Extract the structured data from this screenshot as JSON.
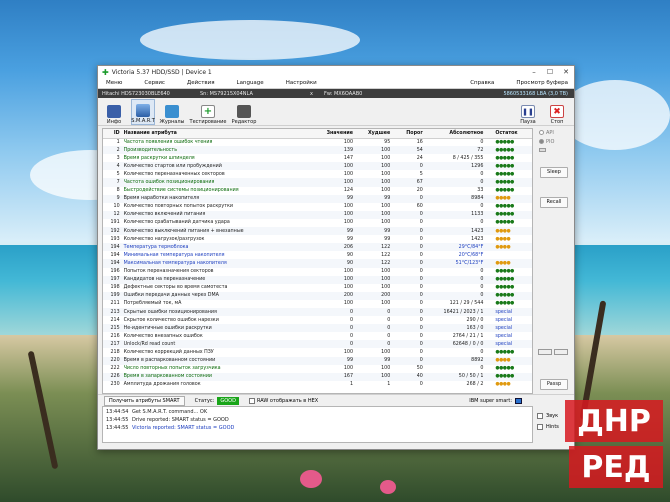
{
  "window": {
    "title": "Victoria 5.37 HDD/SSD | Device 1",
    "controls": [
      "–",
      "☐",
      "✕"
    ]
  },
  "menu": [
    "Меню",
    "Сервис",
    "Действия",
    "Language",
    "Настройки",
    "Справка",
    "Просмотр буфера"
  ],
  "device": {
    "model": "Hitachi HDS723030BLE640",
    "serial": "Sn: MS79215X04NLA",
    "sep": "x",
    "firmware": "Fw: MX6OAAB0",
    "capacity": "5860533168 LBA (3,0 TB)"
  },
  "toolbar": {
    "info": "Инфо",
    "smart": "S.M.A.R.T",
    "journals": "Журналы",
    "testing": "Тестирование",
    "editor": "Редактор",
    "pause": "Пауза",
    "stop": "Стоп"
  },
  "table": {
    "headers": [
      "ID",
      "Название атрибута",
      "Значение",
      "Худшее",
      "Порог",
      "Абсолютное",
      "Остаток"
    ],
    "rows": [
      {
        "id": "1",
        "name": "Частота появления ошибок чтения",
        "val": "100",
        "worst": "95",
        "thr": "16",
        "raw": "0",
        "rem": "●●●●●",
        "cls": "good",
        "remtype": "green"
      },
      {
        "id": "2",
        "name": "Производительность",
        "val": "139",
        "worst": "100",
        "thr": "54",
        "raw": "72",
        "rem": "●●●●●",
        "cls": "good",
        "remtype": "green"
      },
      {
        "id": "3",
        "name": "Время раскрутки шпинделя",
        "val": "147",
        "worst": "100",
        "thr": "24",
        "raw": "8 / 425 / 355",
        "rem": "●●●●●",
        "cls": "good",
        "remtype": "green"
      },
      {
        "id": "4",
        "name": "Количество стартов или пробуждений",
        "val": "100",
        "worst": "100",
        "thr": "0",
        "raw": "1296",
        "rem": "●●●●●",
        "cls": "",
        "remtype": "green"
      },
      {
        "id": "5",
        "name": "Количество переназначенных секторов",
        "val": "100",
        "worst": "100",
        "thr": "5",
        "raw": "0",
        "rem": "●●●●●",
        "cls": "",
        "remtype": "green"
      },
      {
        "id": "7",
        "name": "Частота ошибок позиционирования",
        "val": "100",
        "worst": "100",
        "thr": "67",
        "raw": "0",
        "rem": "●●●●●",
        "cls": "good",
        "remtype": "green"
      },
      {
        "id": "8",
        "name": "Быстродействие системы позиционирования",
        "val": "124",
        "worst": "100",
        "thr": "20",
        "raw": "33",
        "rem": "●●●●●",
        "cls": "good",
        "remtype": "green"
      },
      {
        "id": "9",
        "name": "Время наработки накопителя",
        "val": "99",
        "worst": "99",
        "thr": "0",
        "raw": "8984",
        "rem": "●●●●",
        "cls": "",
        "remtype": "orange"
      },
      {
        "id": "10",
        "name": "Количество повторных попыток раскрутки",
        "val": "100",
        "worst": "100",
        "thr": "60",
        "raw": "0",
        "rem": "●●●●●",
        "cls": "",
        "remtype": "green"
      },
      {
        "id": "12",
        "name": "Количество включений питания",
        "val": "100",
        "worst": "100",
        "thr": "0",
        "raw": "1133",
        "rem": "●●●●●",
        "cls": "",
        "remtype": "green"
      },
      {
        "id": "191",
        "name": "Количество срабатываний датчика удара",
        "val": "100",
        "worst": "100",
        "thr": "0",
        "raw": "0",
        "rem": "●●●●●",
        "cls": "",
        "remtype": "green"
      },
      {
        "id": "192",
        "name": "Количество выключений питания + внезапные",
        "val": "99",
        "worst": "99",
        "thr": "0",
        "raw": "1423",
        "rem": "●●●●",
        "cls": "",
        "remtype": "orange"
      },
      {
        "id": "193",
        "name": "Количество нагрузок/разгрузок",
        "val": "99",
        "worst": "99",
        "thr": "0",
        "raw": "1423",
        "rem": "●●●●",
        "cls": "",
        "remtype": "orange"
      },
      {
        "id": "194",
        "name": "Температура термоблока",
        "val": "206",
        "worst": "122",
        "thr": "0",
        "raw": "29°C/84°F",
        "rem": "●●●●",
        "cls": "blue",
        "remtype": "orange"
      },
      {
        "id": "194",
        "name": "Минимальная температура накопителя",
        "val": "90",
        "worst": "122",
        "thr": "0",
        "raw": "20°C/68°F",
        "rem": "",
        "cls": "blue",
        "remtype": "orange"
      },
      {
        "id": "194",
        "name": "Максимальная температура накопителя",
        "val": "90",
        "worst": "122",
        "thr": "0",
        "raw": "51°C/123°F",
        "rem": "●●●●",
        "cls": "blue",
        "remtype": "orange"
      },
      {
        "id": "196",
        "name": "Попыток переназначения секторов",
        "val": "100",
        "worst": "100",
        "thr": "0",
        "raw": "0",
        "rem": "●●●●●",
        "cls": "",
        "remtype": "green"
      },
      {
        "id": "197",
        "name": "Кандидатов на переназначение",
        "val": "100",
        "worst": "100",
        "thr": "0",
        "raw": "0",
        "rem": "●●●●●",
        "cls": "",
        "remtype": "green"
      },
      {
        "id": "198",
        "name": "Дефектные секторы во время самотеста",
        "val": "100",
        "worst": "100",
        "thr": "0",
        "raw": "0",
        "rem": "●●●●●",
        "cls": "",
        "remtype": "green"
      },
      {
        "id": "199",
        "name": "Ошибки передачи данных через DMA",
        "val": "200",
        "worst": "200",
        "thr": "0",
        "raw": "0",
        "rem": "●●●●●",
        "cls": "",
        "remtype": "green"
      },
      {
        "id": "211",
        "name": "Потребляемый ток, мА",
        "val": "100",
        "worst": "100",
        "thr": "0",
        "raw": "121 / 29 / 544",
        "rem": "●●●●●",
        "cls": "",
        "remtype": "green"
      },
      {
        "id": "213",
        "name": "Скрытые ошибки позиционирования",
        "val": "0",
        "worst": "0",
        "thr": "0",
        "raw": "16421 / 2023 / 1",
        "rem": "special",
        "cls": "",
        "remtype": "special"
      },
      {
        "id": "214",
        "name": "Скрытое количество ошибок нарезки",
        "val": "0",
        "worst": "0",
        "thr": "0",
        "raw": "290 / 0",
        "rem": "special",
        "cls": "",
        "remtype": "special"
      },
      {
        "id": "215",
        "name": "Не-идентичные ошибки раскрутки",
        "val": "0",
        "worst": "0",
        "thr": "0",
        "raw": "163 / 0",
        "rem": "special",
        "cls": "",
        "remtype": "special"
      },
      {
        "id": "216",
        "name": "Количество внезапных ошибок",
        "val": "0",
        "worst": "0",
        "thr": "0",
        "raw": "2764 / 21 / 1",
        "rem": "special",
        "cls": "",
        "remtype": "special"
      },
      {
        "id": "217",
        "name": "Unlock/Rd read count",
        "val": "0",
        "worst": "0",
        "thr": "0",
        "raw": "62648 / 0 / 0",
        "rem": "special",
        "cls": "",
        "remtype": "special"
      },
      {
        "id": "218",
        "name": "Количество коррекций данных ПЗУ",
        "val": "100",
        "worst": "100",
        "thr": "0",
        "raw": "0",
        "rem": "●●●●●",
        "cls": "",
        "remtype": "green"
      },
      {
        "id": "220",
        "name": "Время в распаркованном состоянии",
        "val": "99",
        "worst": "99",
        "thr": "0",
        "raw": "8892",
        "rem": "●●●●",
        "cls": "",
        "remtype": "orange"
      },
      {
        "id": "222",
        "name": "Число повторных попыток загрузчика",
        "val": "100",
        "worst": "100",
        "thr": "50",
        "raw": "0",
        "rem": "●●●●●",
        "cls": "good",
        "remtype": "green"
      },
      {
        "id": "226",
        "name": "Время в запаркованном состоянии",
        "val": "167",
        "worst": "100",
        "thr": "40",
        "raw": "50 / 50 / 1",
        "rem": "●●●●●",
        "cls": "good",
        "remtype": "green"
      },
      {
        "id": "230",
        "name": "Амплитуда дрожания головок",
        "val": "1",
        "worst": "1",
        "thr": "0",
        "raw": "268 / 2",
        "rem": "●●●●",
        "cls": "",
        "remtype": "orange"
      }
    ]
  },
  "side": {
    "api": "API",
    "pio": "PIO",
    "sleep": "Sleep",
    "recall": "Recall",
    "passp": "Passp"
  },
  "status": {
    "get_attrs": "Получить атрибуты SMART",
    "status_label": "Статус:",
    "status_value": "GOOD",
    "raw_hex": "RAW отображать в HEX",
    "ibm_label": "IBM super smart:"
  },
  "log": [
    {
      "time": "13:44:54",
      "msg": "Get S.M.A.R.T. command... OK",
      "cls": ""
    },
    {
      "time": "13:44:55",
      "msg": "Drive reported: SMART status = GOOD",
      "cls": ""
    },
    {
      "time": "13:44:55",
      "msg": "Victoria reported: SMART status = GOOD",
      "cls": "blue"
    }
  ],
  "log_side": {
    "sound": "Звук",
    "hints": "Hints"
  },
  "watermark": {
    "line1": "ДНР",
    "line2": "РЕД"
  },
  "colors": {
    "status_good": "#19a519",
    "good_text": "#0a6a0a",
    "blue_text": "#1b3dbf",
    "device_bar": "#3d3d3d"
  }
}
